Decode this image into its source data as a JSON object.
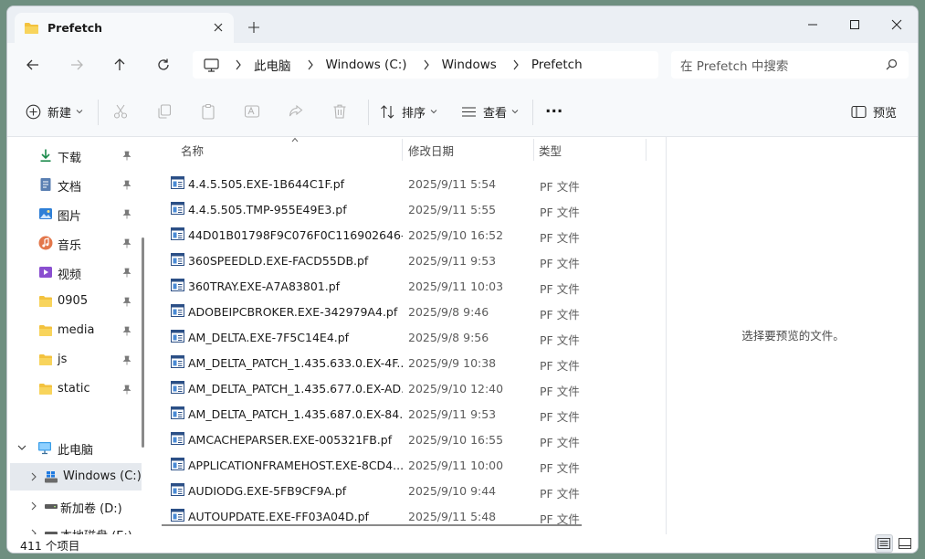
{
  "tab": {
    "title": "Prefetch"
  },
  "address": {
    "crumbs": [
      "此电脑",
      "Windows (C:)",
      "Windows",
      "Prefetch"
    ]
  },
  "search": {
    "placeholder": "在 Prefetch 中搜索"
  },
  "toolbar": {
    "new_label": "新建",
    "sort_label": "排序",
    "view_label": "查看",
    "more_label": "...",
    "preview_label": "预览"
  },
  "sidebar": {
    "items": [
      {
        "label": "下载",
        "icon": "download-icon"
      },
      {
        "label": "文档",
        "icon": "document-icon"
      },
      {
        "label": "图片",
        "icon": "pictures-icon"
      },
      {
        "label": "音乐",
        "icon": "music-icon"
      },
      {
        "label": "视频",
        "icon": "video-icon"
      },
      {
        "label": "0905",
        "icon": "folder-icon"
      },
      {
        "label": "media",
        "icon": "folder-icon"
      },
      {
        "label": "js",
        "icon": "folder-icon"
      },
      {
        "label": "static",
        "icon": "folder-icon"
      }
    ],
    "this_pc": "此电脑",
    "drives": [
      "Windows (C:)",
      "新加卷 (D:)",
      "本地磁盘 (E:)"
    ]
  },
  "columns": {
    "name": "名称",
    "date": "修改日期",
    "type": "类型"
  },
  "files": [
    {
      "name": "4.4.5.505.EXE-1B644C1F.pf",
      "date": "2025/9/11 5:54",
      "type": "PF 文件"
    },
    {
      "name": "4.4.5.505.TMP-955E49E3.pf",
      "date": "2025/9/11 5:55",
      "type": "PF 文件"
    },
    {
      "name": "44D01B01798F9C076F0C116902646-...",
      "date": "2025/9/10 16:52",
      "type": "PF 文件"
    },
    {
      "name": "360SPEEDLD.EXE-FACD55DB.pf",
      "date": "2025/9/11 9:53",
      "type": "PF 文件"
    },
    {
      "name": "360TRAY.EXE-A7A83801.pf",
      "date": "2025/9/11 10:03",
      "type": "PF 文件"
    },
    {
      "name": "ADOBEIPCBROKER.EXE-342979A4.pf",
      "date": "2025/9/8 9:46",
      "type": "PF 文件"
    },
    {
      "name": "AM_DELTA.EXE-7F5C14E4.pf",
      "date": "2025/9/8 9:56",
      "type": "PF 文件"
    },
    {
      "name": "AM_DELTA_PATCH_1.435.633.0.EX-4F...",
      "date": "2025/9/9 10:38",
      "type": "PF 文件"
    },
    {
      "name": "AM_DELTA_PATCH_1.435.677.0.EX-AD...",
      "date": "2025/9/10 12:40",
      "type": "PF 文件"
    },
    {
      "name": "AM_DELTA_PATCH_1.435.687.0.EX-84...",
      "date": "2025/9/11 9:53",
      "type": "PF 文件"
    },
    {
      "name": "AMCACHEPARSER.EXE-005321FB.pf",
      "date": "2025/9/10 16:55",
      "type": "PF 文件"
    },
    {
      "name": "APPLICATIONFRAMEHOST.EXE-8CD4...",
      "date": "2025/9/11 10:00",
      "type": "PF 文件"
    },
    {
      "name": "AUDIODG.EXE-5FB9CF9A.pf",
      "date": "2025/9/10 9:44",
      "type": "PF 文件"
    },
    {
      "name": "AUTOUPDATE.EXE-FF03A04D.pf",
      "date": "2025/9/11 5:48",
      "type": "PF 文件"
    }
  ],
  "preview": {
    "empty_text": "选择要预览的文件。"
  },
  "status": {
    "count_text": "411 个项目"
  }
}
